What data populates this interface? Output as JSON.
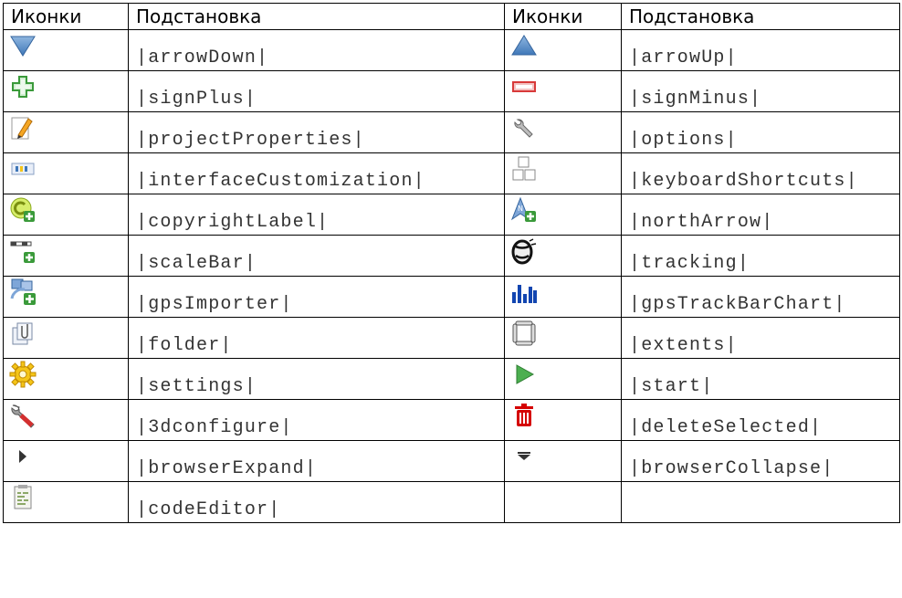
{
  "headers": {
    "icons1": "Иконки",
    "subs1": "Подстановка",
    "icons2": "Иконки",
    "subs2": "Подстановка"
  },
  "rows": [
    {
      "left": {
        "icon": "arrow-down-icon",
        "sub": "|arrowDown|"
      },
      "right": {
        "icon": "arrow-up-icon",
        "sub": "|arrowUp|"
      }
    },
    {
      "left": {
        "icon": "sign-plus-icon",
        "sub": "|signPlus|"
      },
      "right": {
        "icon": "sign-minus-icon",
        "sub": "|signMinus|"
      }
    },
    {
      "left": {
        "icon": "project-properties-icon",
        "sub": "|projectProperties|"
      },
      "right": {
        "icon": "options-icon",
        "sub": "|options|"
      }
    },
    {
      "left": {
        "icon": "interface-customization-icon",
        "sub": "|interfaceCustomization|"
      },
      "right": {
        "icon": "keyboard-shortcuts-icon",
        "sub": "|keyboardShortcuts|"
      }
    },
    {
      "left": {
        "icon": "copyright-label-icon",
        "sub": "|copyrightLabel|"
      },
      "right": {
        "icon": "north-arrow-icon",
        "sub": "|northArrow|"
      }
    },
    {
      "left": {
        "icon": "scale-bar-icon",
        "sub": "|scaleBar|"
      },
      "right": {
        "icon": "tracking-icon",
        "sub": "|tracking|"
      }
    },
    {
      "left": {
        "icon": "gps-importer-icon",
        "sub": "|gpsImporter|"
      },
      "right": {
        "icon": "gps-track-bar-chart-icon",
        "sub": "|gpsTrackBarChart|"
      }
    },
    {
      "left": {
        "icon": "folder-icon",
        "sub": "|folder|"
      },
      "right": {
        "icon": "extents-icon",
        "sub": "|extents|"
      }
    },
    {
      "left": {
        "icon": "settings-icon",
        "sub": "|settings|"
      },
      "right": {
        "icon": "start-icon",
        "sub": "|start|"
      }
    },
    {
      "left": {
        "icon": "3d-configure-icon",
        "sub": "|3dconfigure|"
      },
      "right": {
        "icon": "delete-selected-icon",
        "sub": "|deleteSelected|"
      }
    },
    {
      "left": {
        "icon": "browser-expand-icon",
        "sub": "|browserExpand|"
      },
      "right": {
        "icon": "browser-collapse-icon",
        "sub": "|browserCollapse|"
      }
    },
    {
      "left": {
        "icon": "code-editor-icon",
        "sub": "|codeEditor|"
      },
      "right": {
        "icon": "",
        "sub": ""
      }
    }
  ]
}
